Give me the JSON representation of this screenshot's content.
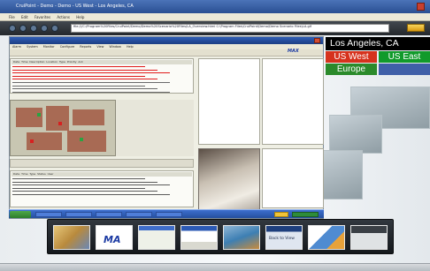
{
  "window": {
    "title": "CruiPoint - Demo - Demo - US West - Los Angeles, CA",
    "menu": [
      "File",
      "Edit",
      "Favorites",
      "Actions",
      "Help"
    ]
  },
  "browser": {
    "address": "file:///C:/Program%20Files/CruiPoint/Demo/Demo%20Scenario%20Files/LA_Overview.html  C:\\Program Files\\CruiPoint\\Demo\\Demo Scenario Files\\LA.gif",
    "go_label": ""
  },
  "app": {
    "title": "",
    "menu": [
      "Alarm",
      "System",
      "Monitor",
      "Configure",
      "Reports",
      "View",
      "Window",
      "Help"
    ],
    "logo": "MAX"
  },
  "alarm_grid": {
    "headers": [
      "Date",
      "Time",
      "Description",
      "Location",
      "Type",
      "Priority",
      "Ack"
    ],
    "rows": 9
  },
  "event_grid": {
    "headers": [
      "Date",
      "Time",
      "Type",
      "Status",
      "User"
    ],
    "rows": 6
  },
  "location": {
    "city": "Los Angeles, CA",
    "sites": [
      {
        "label": "US West",
        "color": "#d6321d",
        "text": "#ffffff"
      },
      {
        "label": "US East",
        "color": "#119a2b",
        "text": "#ffffff"
      },
      {
        "label": "Europe",
        "color": "#2b8a2b",
        "text": "#ffffff"
      },
      {
        "label": "",
        "color": "#3f5fa8",
        "text": "#ffffff"
      }
    ]
  },
  "thumbnails": [
    {
      "icon": "map-icon",
      "label": ""
    },
    {
      "icon": "max-logo-icon",
      "label": "MA"
    },
    {
      "icon": "window-icon",
      "label": ""
    },
    {
      "icon": "dialog-icon",
      "label": ""
    },
    {
      "icon": "photo-icon",
      "label": ""
    },
    {
      "icon": "browser-icon",
      "label": "Back to View"
    },
    {
      "icon": "chart-icon",
      "label": ""
    },
    {
      "icon": "gallery-icon",
      "label": ""
    }
  ],
  "colors": {
    "alarm_text": "#e01b1b",
    "accent_blue": "#1b3aa3"
  }
}
